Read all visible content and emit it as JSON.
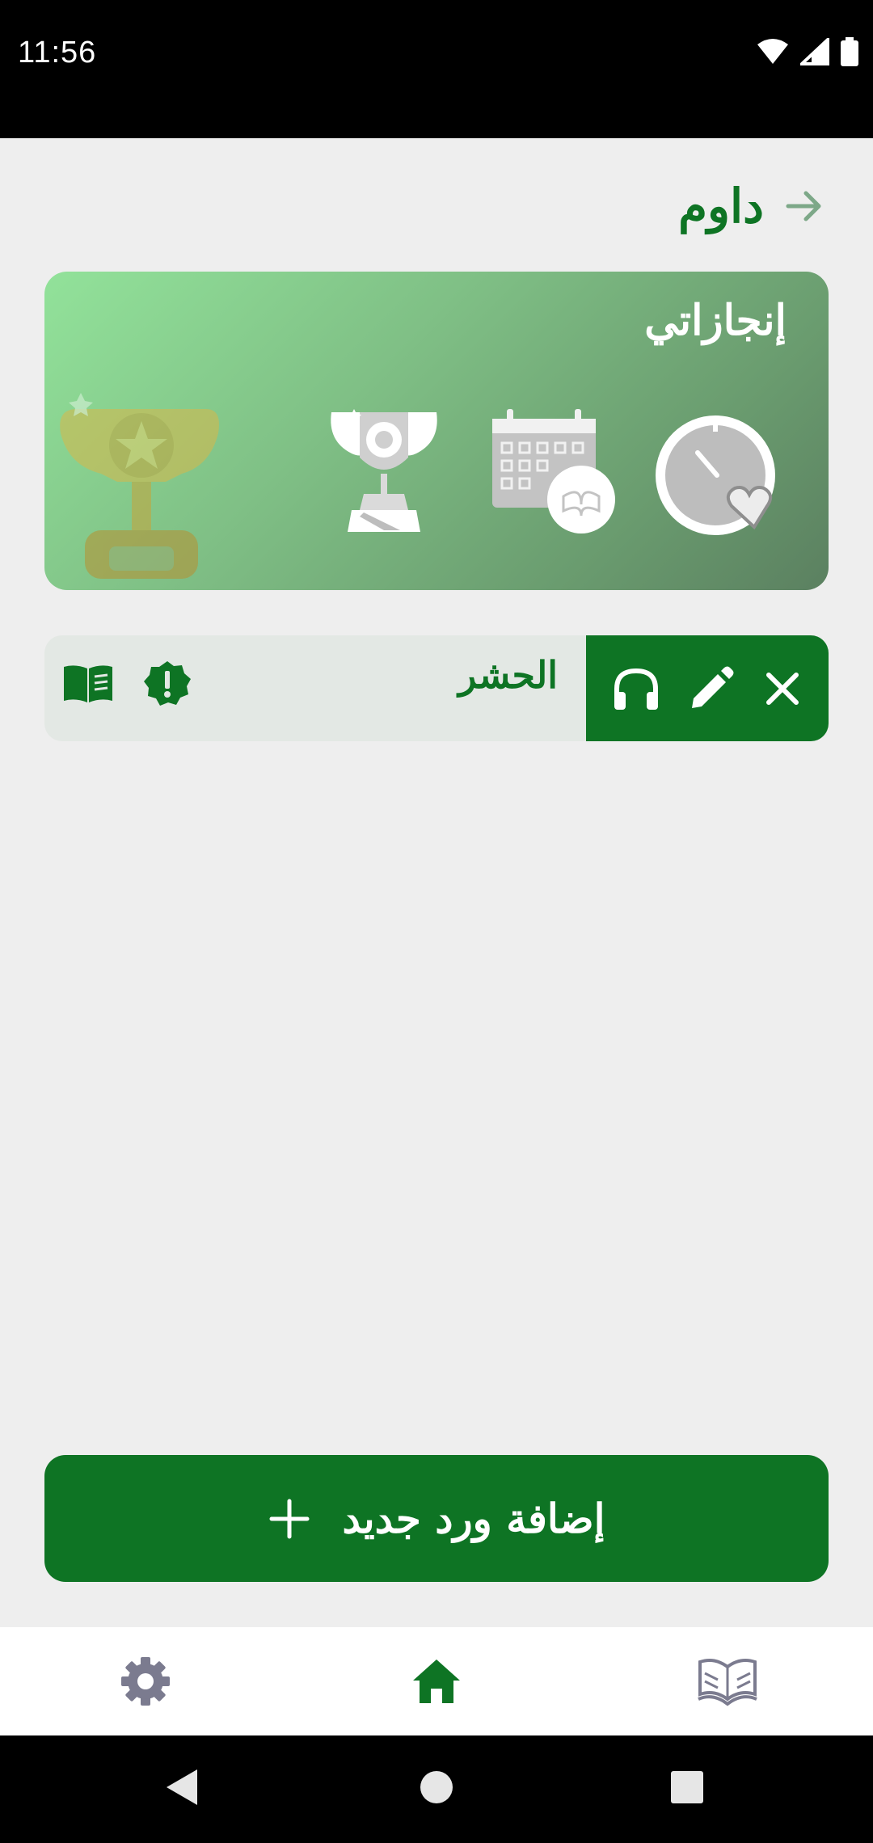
{
  "status_bar": {
    "time": "11:56"
  },
  "header": {
    "title": "داوم"
  },
  "achievements": {
    "title": "إنجازاتي"
  },
  "wird": {
    "name": "الحشر"
  },
  "add_button": {
    "label": "إضافة ورد جديد"
  },
  "colors": {
    "primary": "#0e7424",
    "background": "#eeeeee",
    "row_bg": "#e3e8e4",
    "nav_inactive": "#7b7b8f"
  },
  "icons": {
    "header_back": "arrow-right-icon",
    "achievements": [
      "trophy-icon",
      "calendar-quran-icon",
      "timer-heart-icon"
    ],
    "wird_actions": [
      "close-icon",
      "edit-pencil-icon",
      "headphones-icon"
    ],
    "wird_status": [
      "alert-badge-icon",
      "open-book-icon"
    ],
    "nav": [
      "settings-gear-icon",
      "home-icon",
      "quran-book-icon"
    ]
  }
}
